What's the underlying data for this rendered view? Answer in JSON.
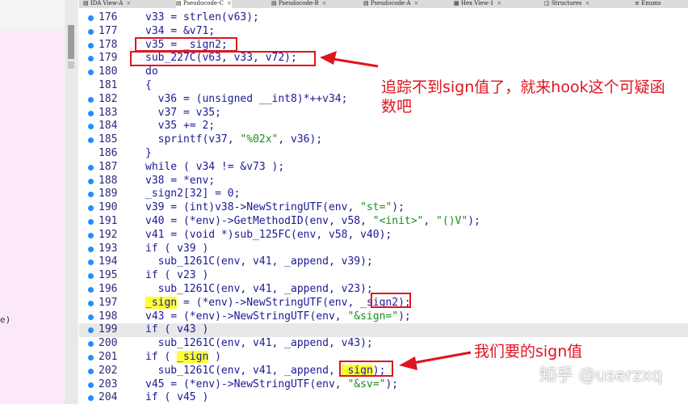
{
  "tabs": [
    {
      "label": "IDA View-A",
      "icon": "document-icon"
    },
    {
      "label": "Pseudocode-C",
      "icon": "document-icon"
    },
    {
      "label": "Pseudocode-B",
      "icon": "document-icon"
    },
    {
      "label": "Pseudocode-A",
      "icon": "document-icon"
    },
    {
      "label": "Hex View-1",
      "icon": "hex-icon"
    },
    {
      "label": "Structures",
      "icon": "structure-icon"
    },
    {
      "label": "Enums",
      "icon": "enum-icon"
    }
  ],
  "tab_close": "×",
  "left_panel_text": "e)",
  "lines": [
    {
      "num": "176",
      "code": "v33 = strlen(v63);"
    },
    {
      "num": "177",
      "code": "v34 = &v71;"
    },
    {
      "num": "178",
      "code": "v35 = _sign2;"
    },
    {
      "num": "179",
      "code": "sub_227C(v63, v33, v72);"
    },
    {
      "num": "180",
      "code": "do"
    },
    {
      "num": "181",
      "code": "{"
    },
    {
      "num": "182",
      "code": "  v36 = (unsigned __int8)*++v34;"
    },
    {
      "num": "183",
      "code": "  v37 = v35;"
    },
    {
      "num": "184",
      "code": "  v35 += 2;"
    },
    {
      "num": "185",
      "code": "  sprintf(v37, \"%02x\", v36);"
    },
    {
      "num": "186",
      "code": "}"
    },
    {
      "num": "187",
      "code": "while ( v34 != &v73 );"
    },
    {
      "num": "188",
      "code": "v38 = *env;"
    },
    {
      "num": "189",
      "code": "_sign2[32] = 0;"
    },
    {
      "num": "190",
      "code": "v39 = (int)v38->NewStringUTF(env, \"st=\");"
    },
    {
      "num": "191",
      "code": "v40 = (*env)->GetMethodID(env, v58, \"<init>\", \"()V\");"
    },
    {
      "num": "192",
      "code": "v41 = (void *)sub_125FC(env, v58, v40);"
    },
    {
      "num": "193",
      "code": "if ( v39 )"
    },
    {
      "num": "194",
      "code": "  sub_1261C(env, v41, _append, v39);"
    },
    {
      "num": "195",
      "code": "if ( v23 )"
    },
    {
      "num": "196",
      "code": "  sub_1261C(env, v41, _append, v23);"
    },
    {
      "num": "197",
      "code": "_sign = (*env)->NewStringUTF(env, _sign2);"
    },
    {
      "num": "198",
      "code": "v43 = (*env)->NewStringUTF(env, \"&sign=\");"
    },
    {
      "num": "199",
      "code": "if ( v43 )"
    },
    {
      "num": "200",
      "code": "  sub_1261C(env, v41, _append, v43);"
    },
    {
      "num": "201",
      "code": "if ( _sign )"
    },
    {
      "num": "202",
      "code": "  sub_1261C(env, v41, _append, _sign);"
    },
    {
      "num": "203",
      "code": "v45 = (*env)->NewStringUTF(env, \"&sv=\");"
    },
    {
      "num": "204",
      "code": "if ( v45 )"
    }
  ],
  "annotations": {
    "note1_line1": "追踪不到sign值了，就来hook这个可疑函",
    "note1_line2": "数吧",
    "note2": "我们要的sign值",
    "color": "#e0141e"
  },
  "watermark": "知乎 @userzxq",
  "colors": {
    "code": "#1a1a95",
    "string": "#1e8a1e",
    "highlight": "#ffff33",
    "line_highlight": "#e8e8e8",
    "breakpoint": "#1e8fff"
  }
}
